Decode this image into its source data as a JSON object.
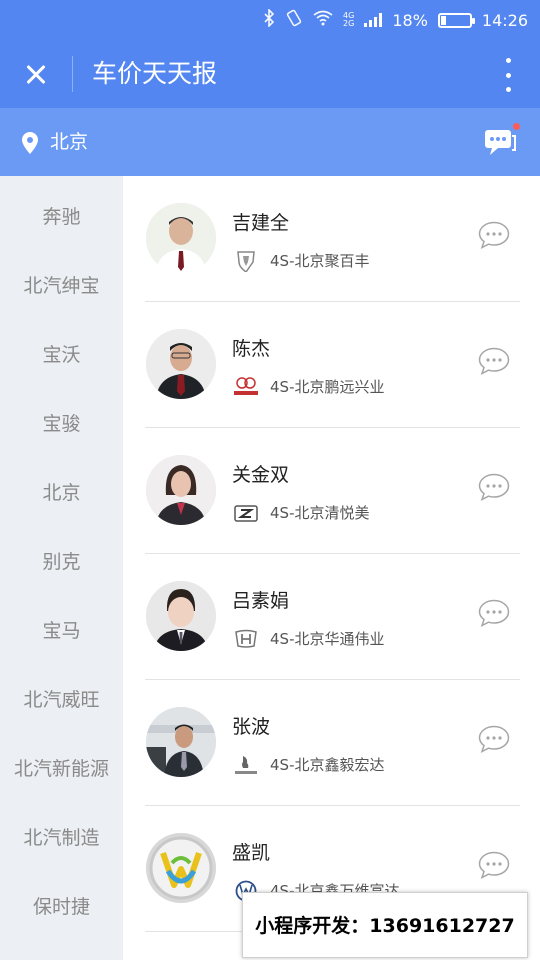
{
  "status_bar": {
    "battery_text": "18%",
    "battery_level": 0.18,
    "time": "14:26",
    "network_top": "4G",
    "network_bottom": "2G",
    "icons": [
      "bluetooth-icon",
      "vibrate-icon",
      "wifi-icon",
      "signal-icon",
      "battery-icon"
    ]
  },
  "title_bar": {
    "title": "车价天天报",
    "close_icon": "close-icon",
    "more_icon": "more-vertical-icon"
  },
  "location_bar": {
    "city": "北京",
    "pin_icon": "location-pin-icon",
    "message_icon": "message-icon"
  },
  "sidebar": {
    "items": [
      "奔驰",
      "北汽绅宝",
      "宝沃",
      "宝骏",
      "北京",
      "别克",
      "宝马",
      "北汽威旺",
      "北汽新能源",
      "北汽制造",
      "保时捷"
    ]
  },
  "contacts": [
    {
      "name": "吉建全",
      "dealer": "4S-北京聚百丰",
      "brand_icon": "shield-brand-icon"
    },
    {
      "name": "陈杰",
      "dealer": "4S-北京鹏远兴业",
      "brand_icon": "beijing-auto-icon"
    },
    {
      "name": "关金双",
      "dealer": "4S-北京清悦美",
      "brand_icon": "z-brand-icon"
    },
    {
      "name": "吕素娟",
      "dealer": "4S-北京华通伟业",
      "brand_icon": "honda-icon"
    },
    {
      "name": "张波",
      "dealer": "4S-北京鑫毅宏达",
      "brand_icon": "peugeot-icon"
    },
    {
      "name": "盛凯",
      "dealer": "4S-北京鑫万维富达",
      "brand_icon": "volkswagen-icon"
    }
  ],
  "watermark": "小程序开发：13691612727",
  "colors": {
    "header": "#5386f0",
    "location_bar": "#6a9af3",
    "sidebar_bg": "#eceff3",
    "badge": "#ff5b5b"
  }
}
